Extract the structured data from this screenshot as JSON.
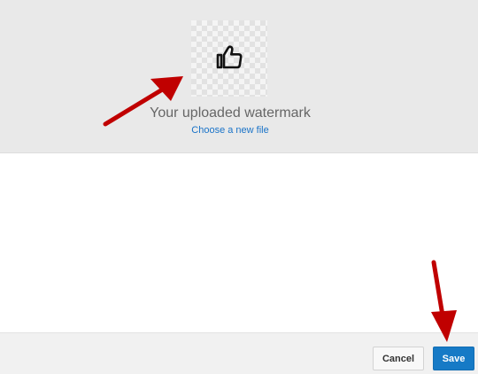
{
  "upload": {
    "caption": "Your uploaded watermark",
    "choose_link": "Choose a new file",
    "preview_icon": "thumbs-up-icon"
  },
  "footer": {
    "cancel_label": "Cancel",
    "save_label": "Save"
  },
  "colors": {
    "accent": "#167ac6",
    "link": "#1a73c8",
    "annotation_arrow": "#c00000",
    "panel_bg": "#e9e9e9"
  }
}
